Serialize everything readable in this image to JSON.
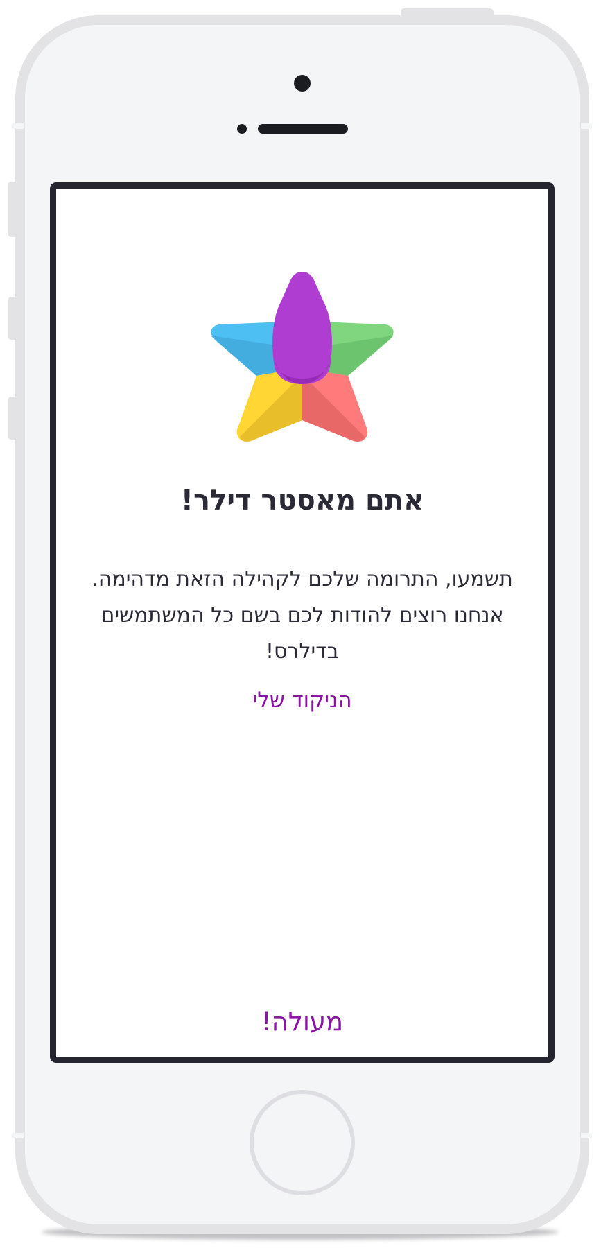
{
  "dialog": {
    "title": "אתם מאסטר דילר!",
    "message": "תשמעו, התרומה שלכם לקהילה הזאת מדהימה. אנחנו רוצים להודות לכם בשם כל המשתמשים בדילרס!",
    "my_points_link": "הניקוד שלי",
    "confirm_button": "מעולה!"
  },
  "colors": {
    "accent": "#8a14a3",
    "text": "#2a2a36",
    "screen_border": "#25252f",
    "phone_body": "#f4f5f7",
    "phone_frame": "#e3e3e6"
  },
  "icons": {
    "logo": "multicolor-star-icon"
  }
}
